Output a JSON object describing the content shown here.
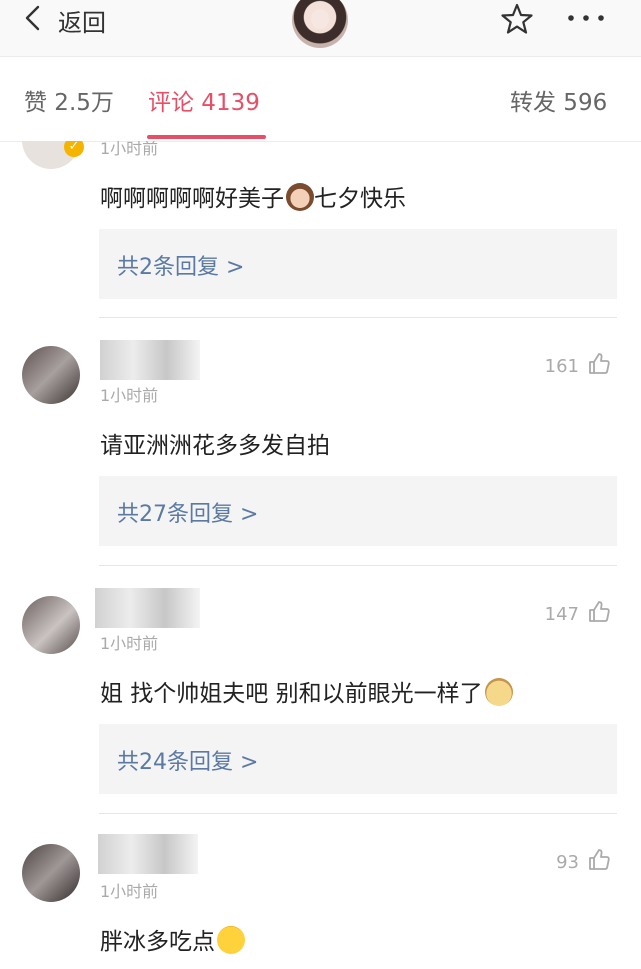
{
  "header": {
    "back_label": "返回",
    "icons": {
      "back": "chevron-left-icon",
      "favorite": "star-icon",
      "more": "more-dots-icon"
    }
  },
  "tabs": [
    {
      "label": "赞 2.5万",
      "active": false
    },
    {
      "label": "评论 4139",
      "active": true
    },
    {
      "label": "转发 596",
      "active": false
    }
  ],
  "colors": {
    "accent": "#e84f67",
    "link": "#5b7aa3",
    "muted": "#aaaaaa"
  },
  "comments": [
    {
      "time": "1小时前",
      "text": "啊啊啊啊啊好美子",
      "text_suffix": "七夕快乐",
      "likes": "",
      "reply_label": "共2条回复 >",
      "emoji": "girl-emoji"
    },
    {
      "time": "1小时前",
      "text": "请亚洲洲花多多发自拍",
      "likes": "161",
      "reply_label": "共27条回复 >"
    },
    {
      "time": "1小时前",
      "text": "姐 找个帅姐夫吧 别和以前眼光一样了",
      "likes": "147",
      "reply_label": "共24条回复 >",
      "emoji": "doge-emoji"
    },
    {
      "time": "1小时前",
      "text": "胖冰多吃点",
      "likes": "93",
      "emoji": "crying-emoji"
    }
  ]
}
